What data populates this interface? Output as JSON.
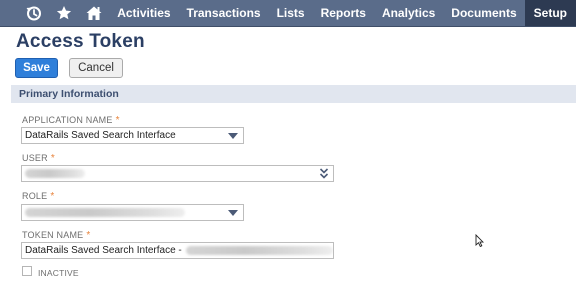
{
  "nav": {
    "items": [
      {
        "label": "Activities"
      },
      {
        "label": "Transactions"
      },
      {
        "label": "Lists"
      },
      {
        "label": "Reports"
      },
      {
        "label": "Analytics"
      },
      {
        "label": "Documents"
      },
      {
        "label": "Setup",
        "active": true
      }
    ],
    "icons": [
      "recent-records-icon",
      "favorites-star-icon",
      "home-icon"
    ],
    "colors": {
      "bar": "#5a6c8a",
      "active": "#2d3a52"
    }
  },
  "page": {
    "title": "Access Token"
  },
  "buttons": {
    "save": "Save",
    "cancel": "Cancel"
  },
  "section": {
    "title": "Primary Information"
  },
  "form": {
    "application_name": {
      "label": "APPLICATION NAME",
      "required_mark": "*",
      "value": "DataRails Saved Search Interface"
    },
    "user": {
      "label": "USER",
      "required_mark": "*",
      "value": ""
    },
    "role": {
      "label": "ROLE",
      "required_mark": "*",
      "value": ""
    },
    "token_name": {
      "label": "TOKEN NAME",
      "required_mark": "*",
      "value": "DataRails Saved Search Interface -"
    },
    "inactive": {
      "label": "INACTIVE",
      "checked": false
    }
  },
  "colors": {
    "title": "#2b3f64",
    "save_button": "#2f7fda",
    "section_header_bg": "#e1e6ef",
    "required": "#e8843c"
  }
}
